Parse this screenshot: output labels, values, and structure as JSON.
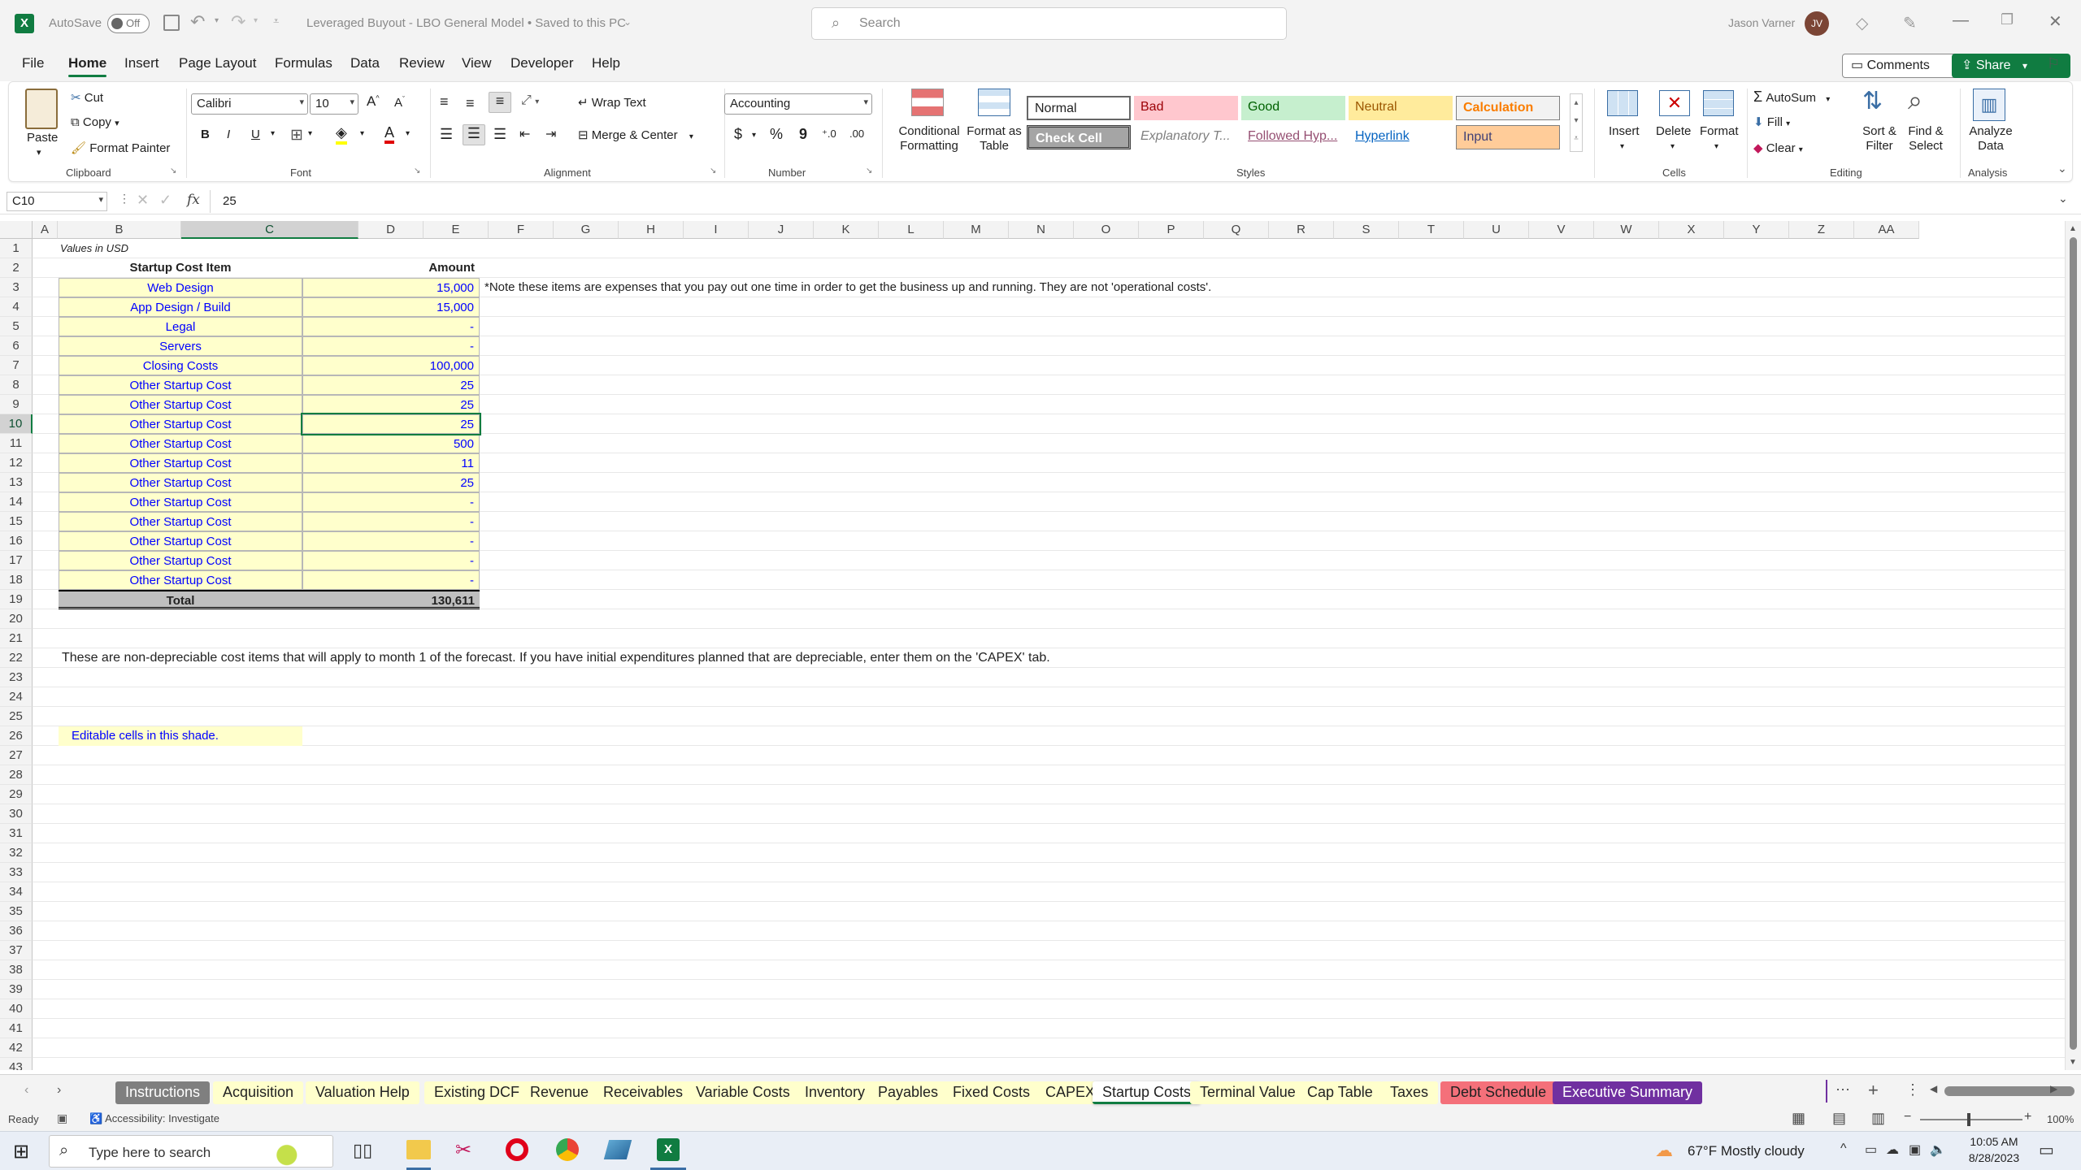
{
  "titlebar": {
    "autosave_label": "AutoSave",
    "autosave_state": "Off",
    "doc_title": "Leveraged Buyout - LBO General Model • Saved to this PC",
    "search_placeholder": "Search",
    "user_name": "Jason Varner",
    "user_initials": "JV"
  },
  "menu": {
    "items": [
      "File",
      "Home",
      "Insert",
      "Page Layout",
      "Formulas",
      "Data",
      "Review",
      "View",
      "Developer",
      "Help"
    ],
    "active": "Home",
    "comments_label": "Comments",
    "share_label": "Share"
  },
  "ribbon": {
    "clipboard": {
      "paste": "Paste",
      "cut": "Cut",
      "copy": "Copy",
      "format_painter": "Format Painter",
      "group": "Clipboard"
    },
    "font": {
      "name": "Calibri",
      "size": "10",
      "group": "Font",
      "bold": "B",
      "italic": "I",
      "underline": "U"
    },
    "alignment": {
      "wrap_text": "Wrap Text",
      "merge_center": "Merge & Center",
      "group": "Alignment"
    },
    "number": {
      "format": "Accounting",
      "currency": "$",
      "percent": "%",
      "comma": "9",
      "group": "Number"
    },
    "styles": {
      "conditional_formatting": "Conditional Formatting",
      "format_as_table": "Format as Table",
      "cells": [
        "Normal",
        "Bad",
        "Good",
        "Neutral",
        "Calculation",
        "Check Cell",
        "Explanatory T...",
        "Followed Hyp...",
        "Hyperlink",
        "Input"
      ],
      "group": "Styles"
    },
    "cells": {
      "insert": "Insert",
      "delete": "Delete",
      "format": "Format",
      "group": "Cells"
    },
    "editing": {
      "autosum": "AutoSum",
      "fill": "Fill",
      "clear": "Clear",
      "sort_filter": "Sort & Filter",
      "find_select": "Find & Select",
      "group": "Editing"
    },
    "analysis": {
      "analyze_data": "Analyze Data",
      "group": "Analysis"
    }
  },
  "formula_bar": {
    "name_box": "C10",
    "fx": "fx",
    "value": "25"
  },
  "columns": [
    "A",
    "B",
    "C",
    "D",
    "E",
    "F",
    "G",
    "H",
    "I",
    "J",
    "K",
    "L",
    "M",
    "N",
    "O",
    "P",
    "Q",
    "R",
    "S",
    "T",
    "U",
    "V",
    "W",
    "X",
    "Y",
    "Z",
    "AA"
  ],
  "rows": [
    "1",
    "2",
    "3",
    "4",
    "5",
    "6",
    "7",
    "8",
    "9",
    "10",
    "11",
    "12",
    "13",
    "14",
    "15",
    "16",
    "17",
    "18",
    "19",
    "20",
    "21",
    "22",
    "23",
    "24",
    "25",
    "26",
    "27",
    "28",
    "29",
    "30",
    "31",
    "32",
    "33",
    "34",
    "35",
    "36",
    "37",
    "38",
    "39",
    "40",
    "41",
    "42",
    "43"
  ],
  "sheet": {
    "units_note": "Values in USD",
    "header_item": "Startup Cost Item",
    "header_amount": "Amount",
    "items": [
      {
        "name": "Web Design",
        "amount": "15,000"
      },
      {
        "name": "App Design / Build",
        "amount": "15,000"
      },
      {
        "name": "Legal",
        "amount": "-"
      },
      {
        "name": "Servers",
        "amount": "-"
      },
      {
        "name": "Closing Costs",
        "amount": "100,000"
      },
      {
        "name": "Other Startup Cost",
        "amount": "25"
      },
      {
        "name": "Other Startup Cost",
        "amount": "25"
      },
      {
        "name": "Other Startup Cost",
        "amount": "25"
      },
      {
        "name": "Other Startup Cost",
        "amount": "500"
      },
      {
        "name": "Other Startup Cost",
        "amount": "11"
      },
      {
        "name": "Other Startup Cost",
        "amount": "25"
      },
      {
        "name": "Other Startup Cost",
        "amount": "-"
      },
      {
        "name": "Other Startup Cost",
        "amount": "-"
      },
      {
        "name": "Other Startup Cost",
        "amount": "-"
      },
      {
        "name": "Other Startup Cost",
        "amount": "-"
      },
      {
        "name": "Other Startup Cost",
        "amount": "-"
      }
    ],
    "total_label": "Total",
    "total_amount": "130,611",
    "note": "*Note these items are expenses that you pay out one time in order to get the business up and running. They are not 'operational costs'.",
    "nondep_note": "These are non-depreciable cost items that will apply to month 1 of the forecast. If you have initial expenditures planned that are depreciable, enter them on the 'CAPEX' tab.",
    "editable_note": "Editable cells in this shade."
  },
  "sheet_tabs": [
    {
      "label": "Instructions",
      "style": "gray"
    },
    {
      "label": "Acquisition",
      "style": "yellow"
    },
    {
      "label": "Valuation Help",
      "style": "yellow"
    },
    {
      "label": "Existing DCF",
      "style": "yellow"
    },
    {
      "label": "Revenue",
      "style": "yellow"
    },
    {
      "label": "Receivables",
      "style": "yellow"
    },
    {
      "label": "Variable Costs",
      "style": "yellow"
    },
    {
      "label": "Inventory",
      "style": "yellow"
    },
    {
      "label": "Payables",
      "style": "yellow"
    },
    {
      "label": "Fixed Costs",
      "style": "yellow"
    },
    {
      "label": "CAPEX",
      "style": "yellow"
    },
    {
      "label": "Startup Costs",
      "style": "active"
    },
    {
      "label": "Terminal Value",
      "style": "yellow"
    },
    {
      "label": "Cap Table",
      "style": "yellow"
    },
    {
      "label": "Taxes",
      "style": "yellow"
    },
    {
      "label": "Debt Schedule",
      "style": "red"
    },
    {
      "label": "Executive Summary",
      "style": "purple"
    }
  ],
  "status": {
    "ready": "Ready",
    "accessibility": "Accessibility: Investigate",
    "zoom": "100%"
  },
  "taskbar": {
    "search_placeholder": "Type here to search",
    "weather": "67°F  Mostly cloudy",
    "time": "10:05 AM",
    "date": "8/28/2023"
  },
  "colors": {
    "excel_green": "#107c41",
    "editable_yellow": "#ffffcc",
    "input_blue": "#0000ff",
    "tab_red": "#f4707a",
    "tab_purple": "#7030a0"
  }
}
